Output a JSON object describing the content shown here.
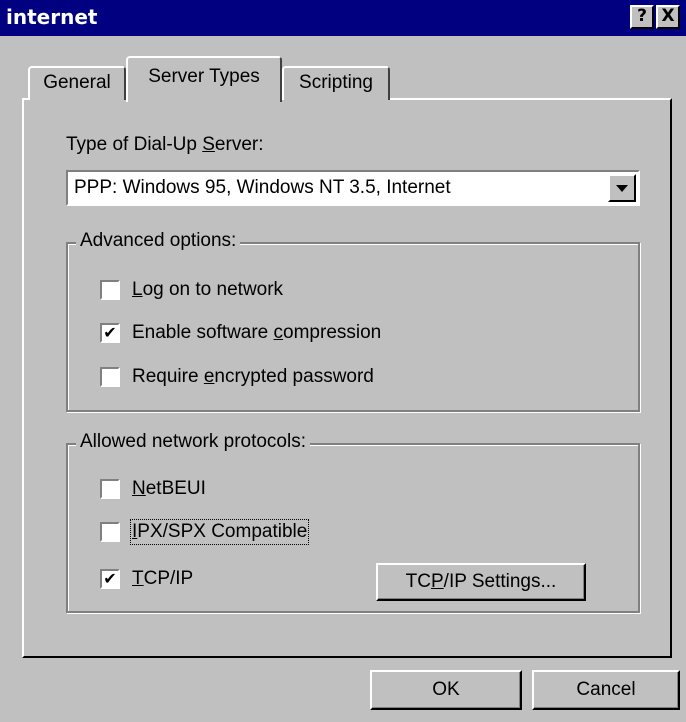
{
  "window": {
    "title": "internet",
    "help_button": "?",
    "close_button": "X"
  },
  "tabs": [
    {
      "label": "General",
      "selected": false
    },
    {
      "label": "Server Types",
      "selected": true
    },
    {
      "label": "Scripting",
      "selected": false
    }
  ],
  "server_type": {
    "label_pre": "Type of Dial-Up ",
    "label_mnemonic": "S",
    "label_post": "erver:",
    "selected_value": "PPP: Windows 95, Windows NT 3.5, Internet"
  },
  "advanced_options": {
    "legend": "Advanced options:",
    "items": [
      {
        "pre": "",
        "mnemonic": "L",
        "post": "og on to network",
        "checked": false
      },
      {
        "pre": "Enable software ",
        "mnemonic": "c",
        "post": "ompression",
        "checked": true
      },
      {
        "pre": "Require ",
        "mnemonic": "e",
        "post": "ncrypted password",
        "checked": false
      }
    ]
  },
  "protocols": {
    "legend": "Allowed network protocols:",
    "items": [
      {
        "pre": "",
        "mnemonic": "N",
        "post": "etBEUI",
        "checked": false
      },
      {
        "pre": "",
        "mnemonic": "I",
        "post": "PX/SPX Compatible",
        "checked": false
      },
      {
        "pre": "",
        "mnemonic": "T",
        "post": "CP/IP",
        "checked": true
      }
    ],
    "settings_button": {
      "pre": "TC",
      "mnemonic": "P",
      "post": "/IP Settings..."
    }
  },
  "footer": {
    "ok": "OK",
    "cancel": "Cancel"
  },
  "check_glyph": "✔"
}
